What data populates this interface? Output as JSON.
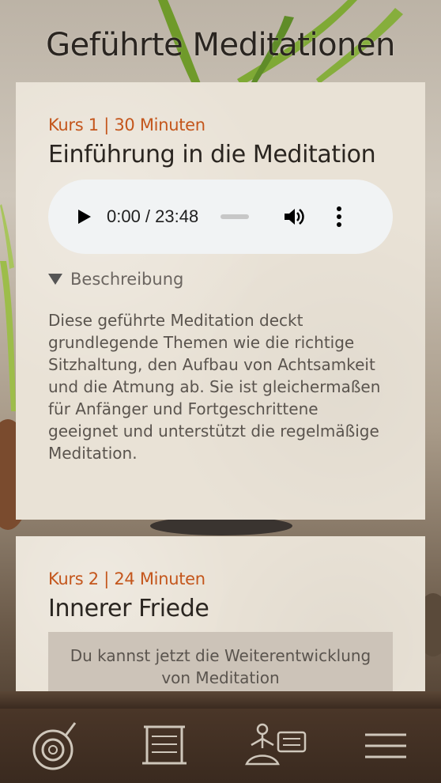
{
  "page": {
    "title": "Geführte Meditationen"
  },
  "courses": [
    {
      "meta": "Kurs 1 | 30 Minuten",
      "title": "Einführung in die Meditation",
      "player": {
        "time": "0:00 / 23:48",
        "progress": 0
      },
      "details_label": "Beschreibung",
      "description": "Diese geführte Meditation deckt grundlegende Themen wie die richtige Sitzhaltung, den Aufbau von Achtsamkeit und die Atmung ab. Sie ist gleichermaßen für Anfänger und Fortgeschrittene geeignet und unterstützt die regelmäßige Meditation."
    },
    {
      "meta": "Kurs 2 | 24 Minuten",
      "title": "Innerer Friede",
      "notice": "Du kannst jetzt die Weiterentwicklung von Meditation"
    }
  ],
  "tabbar": {
    "icons": [
      "meditation-bowl-icon",
      "scroll-icon",
      "meditator-icon",
      "menu-icon"
    ]
  },
  "colors": {
    "accent": "#c4561c",
    "card": "#e9e2d6",
    "player": "#f1f3f4"
  }
}
